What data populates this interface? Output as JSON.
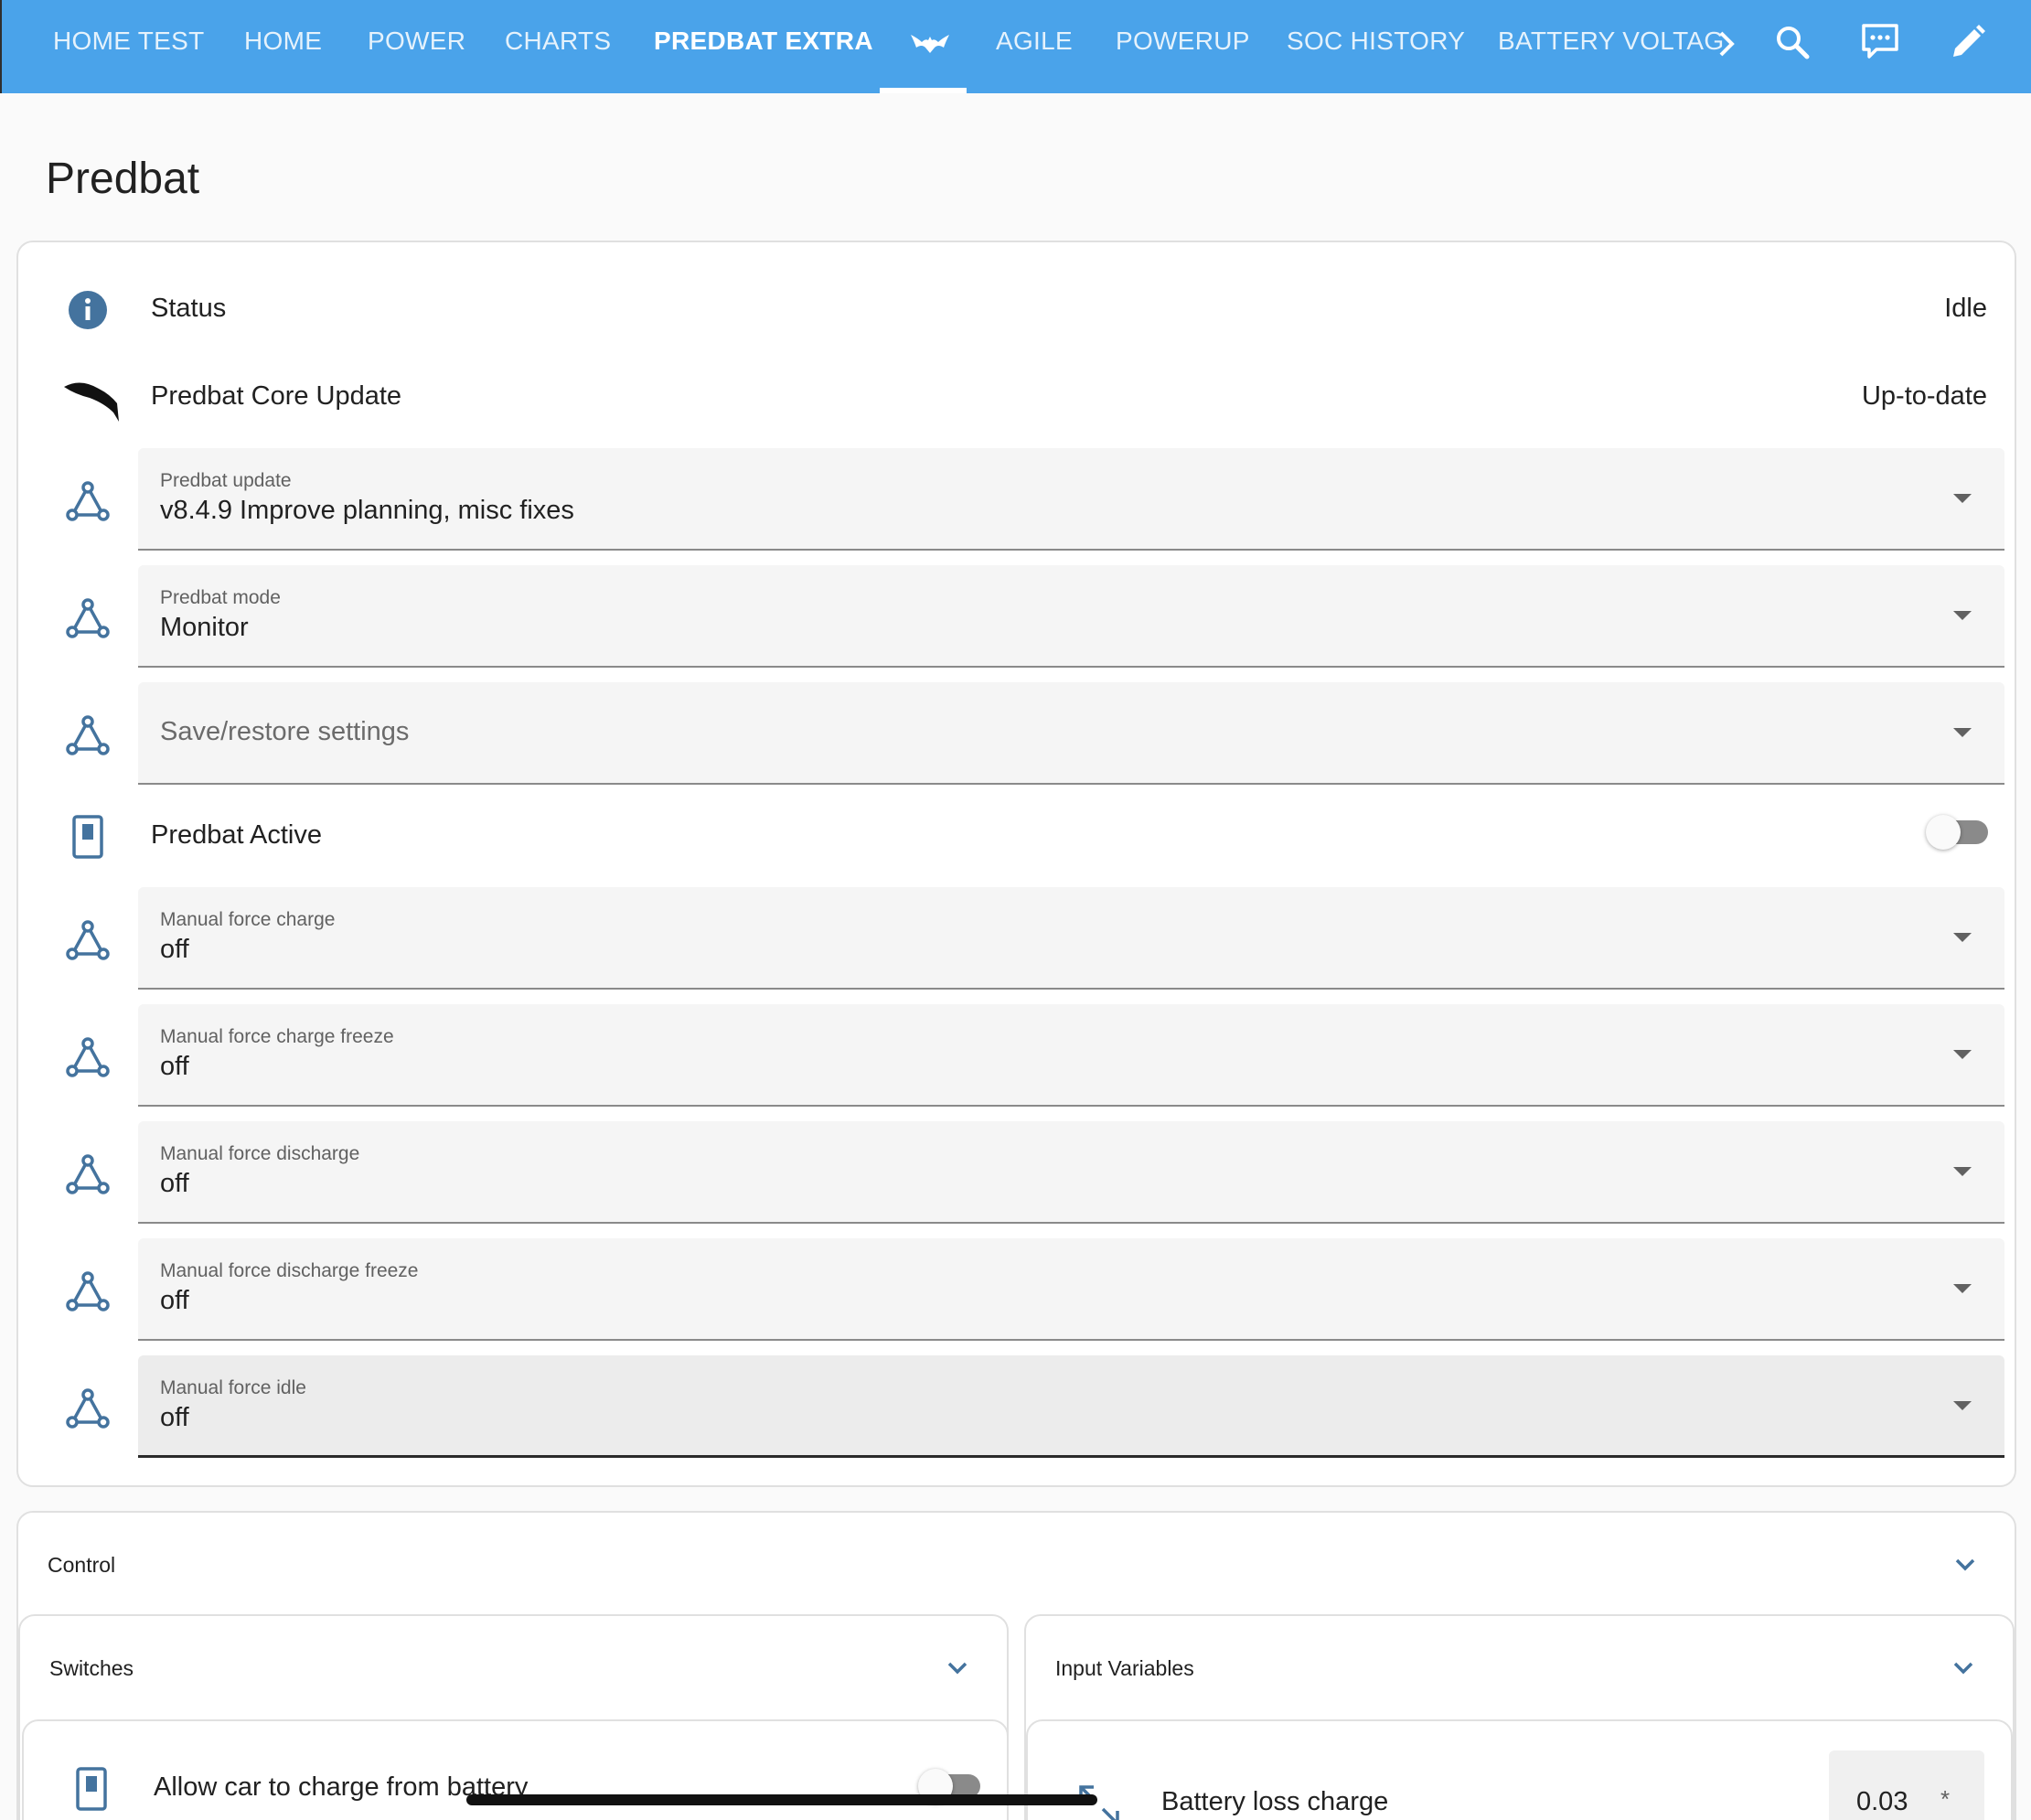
{
  "nav": {
    "tabs": [
      {
        "label": "HOME TEST"
      },
      {
        "label": "HOME"
      },
      {
        "label": "POWER"
      },
      {
        "label": "CHARTS"
      },
      {
        "label": "PREDBAT EXTRA"
      },
      {
        "label": ""
      },
      {
        "label": "AGILE"
      },
      {
        "label": "POWERUP"
      },
      {
        "label": "SOC HISTORY"
      },
      {
        "label": "BATTERY VOLTAG"
      }
    ],
    "active_tab": "bat-icon-tab",
    "icons": [
      "chevron-right-icon",
      "search-icon",
      "assist-icon",
      "pencil-icon"
    ]
  },
  "page": {
    "title": "Predbat"
  },
  "entities": {
    "status": {
      "label": "Status",
      "value": "Idle"
    },
    "core_update": {
      "label": "Predbat Core Update",
      "value": "Up-to-date"
    },
    "predbat_update": {
      "label": "Predbat update",
      "value": "v8.4.9 Improve planning, misc fixes"
    },
    "predbat_mode": {
      "label": "Predbat mode",
      "value": "Monitor"
    },
    "save_restore": {
      "placeholder": "Save/restore settings"
    },
    "predbat_active": {
      "label": "Predbat Active",
      "state": "off"
    },
    "force_charge": {
      "label": "Manual force charge",
      "value": "off"
    },
    "force_charge_freeze": {
      "label": "Manual force charge freeze",
      "value": "off"
    },
    "force_discharge": {
      "label": "Manual force discharge",
      "value": "off"
    },
    "force_discharge_freeze": {
      "label": "Manual force discharge freeze",
      "value": "off"
    },
    "force_idle": {
      "label": "Manual force idle",
      "value": "off"
    }
  },
  "control": {
    "title": "Control"
  },
  "switches": {
    "title": "Switches",
    "allow_car": {
      "label": "Allow car to charge from battery",
      "state": "off"
    }
  },
  "input_variables": {
    "title": "Input Variables",
    "battery_loss_charge": {
      "label": "Battery loss charge",
      "value": "0.03",
      "unit": "*"
    }
  },
  "colors": {
    "header": "#4aa3ea",
    "icon": "#44739e"
  }
}
